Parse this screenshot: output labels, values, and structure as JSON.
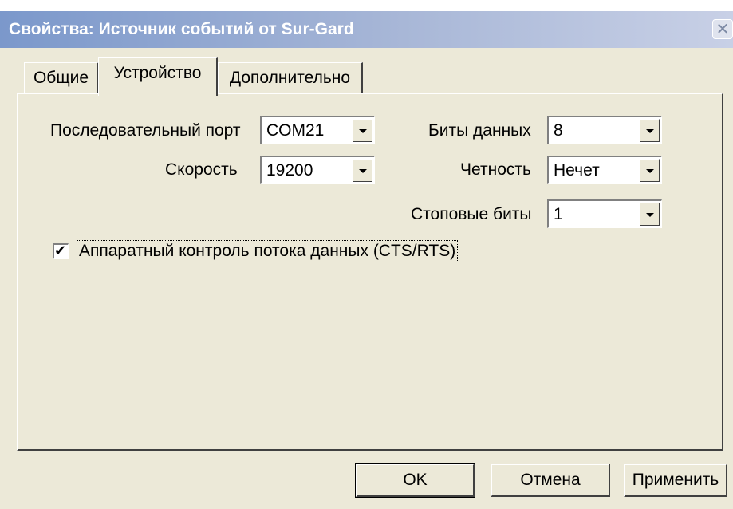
{
  "window": {
    "title": "Свойства: Источник событий от Sur-Gard",
    "close_glyph": "✕"
  },
  "tabs": [
    {
      "label": "Общие",
      "active": false
    },
    {
      "label": "Устройство",
      "active": true
    },
    {
      "label": "Дополнительно",
      "active": false
    }
  ],
  "device": {
    "serial_port": {
      "label": "Последовательный порт",
      "value": "COM21"
    },
    "speed": {
      "label": "Скорость",
      "value": "19200"
    },
    "data_bits": {
      "label": "Биты данных",
      "value": "8"
    },
    "parity": {
      "label": "Четность",
      "value": "Нечет"
    },
    "stop_bits": {
      "label": "Стоповые биты",
      "value": "1"
    },
    "hw_flow_control": {
      "label": "Аппаратный контроль потока данных (CTS/RTS)",
      "checked": true,
      "mark": "✔"
    }
  },
  "buttons": {
    "ok": "OK",
    "cancel": "Отмена",
    "apply": "Применить"
  },
  "colors": {
    "dialog_face": "#ece9d8",
    "title_gradient_start": "#7b98cb",
    "title_gradient_end": "#c8d0e6"
  }
}
